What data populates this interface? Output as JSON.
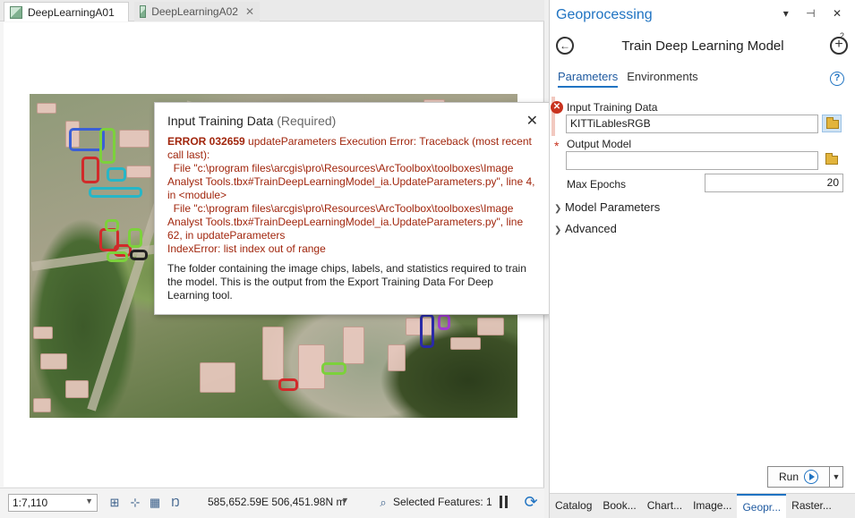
{
  "tabs": [
    {
      "label": "DeepLearningA01",
      "active": true
    },
    {
      "label": "DeepLearningA02",
      "active": false,
      "close": "✕"
    }
  ],
  "popup": {
    "title": "Input Training Data",
    "required": "(Required)",
    "close_glyph": "✕",
    "error_code": "ERROR 032659",
    "error_message": " updateParameters Execution Error: Traceback (most recent call last):\n  File \"c:\\program files\\arcgis\\pro\\Resources\\ArcToolbox\\toolboxes\\Image Analyst Tools.tbx#TrainDeepLearningModel_ia.UpdateParameters.py\", line 4, in <module>\n  File \"c:\\program files\\arcgis\\pro\\Resources\\ArcToolbox\\toolboxes\\Image Analyst Tools.tbx#TrainDeepLearningModel_ia.UpdateParameters.py\", line 62, in updateParameters\nIndexError: list index out of range",
    "description": "The folder containing the image chips, labels, and statistics required to train the model. This is the output from the Export Training Data For Deep Learning tool."
  },
  "statusbar": {
    "scale": "1:7,110",
    "coordinates": "585,652.59E 506,451.98N m",
    "selected_features": "Selected Features: 1"
  },
  "geoprocessing": {
    "pane_title": "Geoprocessing",
    "header_icons": "▾ ⊣ ✕",
    "tool_title": "Train Deep Learning Model",
    "add_badge": "2",
    "tabs": [
      {
        "label": "Parameters",
        "active": true
      },
      {
        "label": "Environments",
        "active": false
      }
    ],
    "params": {
      "input_label": "Input Training Data",
      "input_value": "KITTiLablesRGB",
      "output_label": "Output Model",
      "output_value": "",
      "epochs_label": "Max Epochs",
      "epochs_value": "20"
    },
    "sections": [
      "Model Parameters",
      "Advanced"
    ],
    "run_label": "Run"
  },
  "bottom_tabs": [
    {
      "label": "Catalog",
      "active": false
    },
    {
      "label": "Book...",
      "active": false
    },
    {
      "label": "Chart...",
      "active": false
    },
    {
      "label": "Image...",
      "active": false
    },
    {
      "label": "Geopr...",
      "active": true
    },
    {
      "label": "Raster...",
      "active": false
    }
  ],
  "colors": {
    "accent": "#1f73c2",
    "error": "#a1260d",
    "error_icon": "#c8321e"
  }
}
